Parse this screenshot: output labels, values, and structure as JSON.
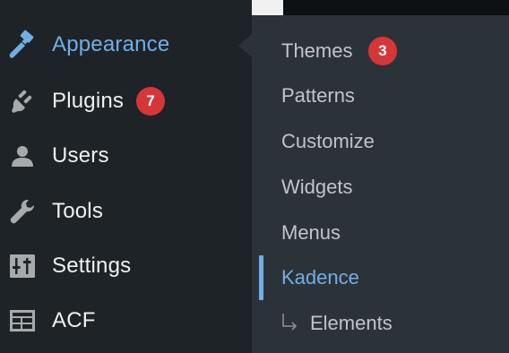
{
  "menu": {
    "items": [
      {
        "label": "Appearance",
        "icon": "paintbrush-icon",
        "active": true
      },
      {
        "label": "Plugins",
        "icon": "plugin-icon",
        "badge": "7"
      },
      {
        "label": "Users",
        "icon": "user-icon"
      },
      {
        "label": "Tools",
        "icon": "wrench-icon"
      },
      {
        "label": "Settings",
        "icon": "sliders-icon"
      },
      {
        "label": "ACF",
        "icon": "table-icon"
      }
    ]
  },
  "submenu": {
    "items": [
      {
        "label": "Themes",
        "badge": "3"
      },
      {
        "label": "Patterns"
      },
      {
        "label": "Customize"
      },
      {
        "label": "Widgets"
      },
      {
        "label": "Menus"
      },
      {
        "label": "Kadence",
        "current": true
      },
      {
        "label": "Elements",
        "child": true
      }
    ]
  },
  "colors": {
    "menu_bg": "#1d2327",
    "submenu_bg": "#2c3338",
    "accent": "#72aee6",
    "badge": "#d63638",
    "text": "#f0f0f1",
    "submenu_text": "#c3c4c7"
  }
}
